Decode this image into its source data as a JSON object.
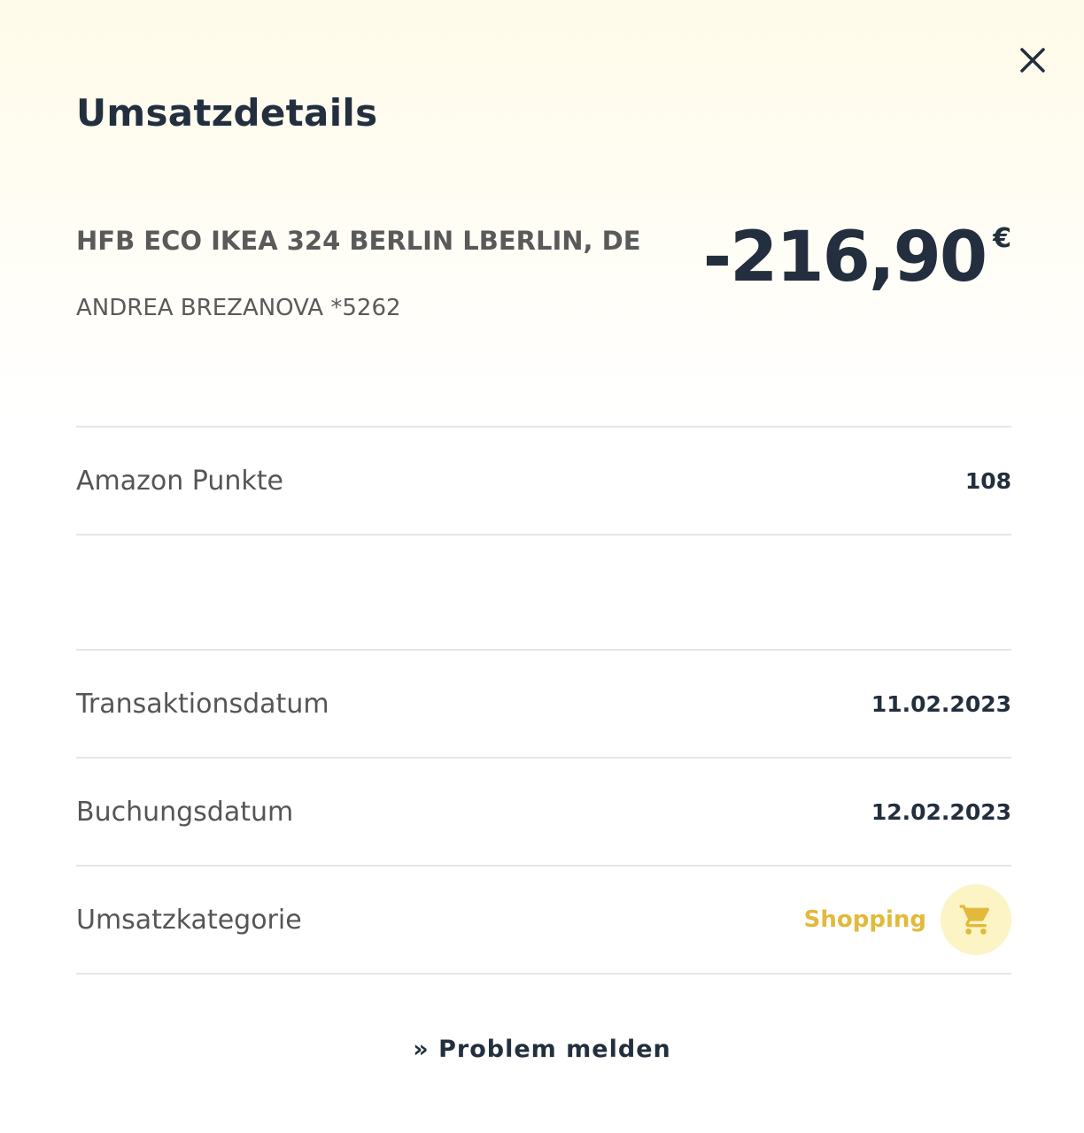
{
  "modal": {
    "title": "Umsatzdetails",
    "close_icon": "close-icon"
  },
  "transaction": {
    "merchant": "HFB ECO IKEA 324 BERLIN LBERLIN, DE",
    "cardholder": "ANDREA BREZANOVA *5262",
    "amount": "-216,90",
    "currency": "€"
  },
  "details": {
    "points_label": "Amazon Punkte",
    "points_value": "108",
    "transaction_date_label": "Transaktionsdatum",
    "transaction_date_value": "11.02.2023",
    "booking_date_label": "Buchungsdatum",
    "booking_date_value": "12.02.2023",
    "category_label": "Umsatzkategorie",
    "category_value": "Shopping",
    "category_icon": "shopping-cart-icon"
  },
  "actions": {
    "report_problem": "» Problem melden"
  },
  "colors": {
    "text_dark": "#232f3e",
    "text_muted": "#555555",
    "category_accent": "#e2b93b",
    "category_icon_bg": "#fdf4c6",
    "divider": "#e6e6e6",
    "header_tint": "#fffbea"
  }
}
